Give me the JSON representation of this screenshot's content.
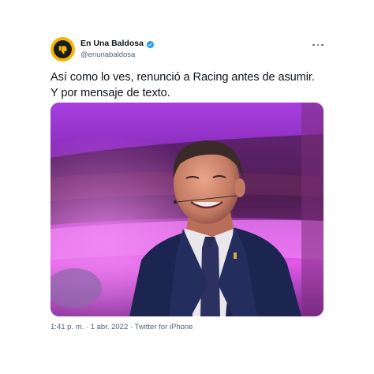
{
  "account": {
    "display_name": "En Una Baldosa",
    "handle": "@enunabaldosa",
    "verified": true,
    "avatar_icon": "thumbs-down-logo-icon",
    "avatar_color": "#f2b705"
  },
  "tweet": {
    "text": "Así como lo ves, renunció a Racing antes de asumir. Y por mensaje de texto.",
    "time": "1:41 p. m.",
    "date": "1 abr. 2022",
    "source": "Twitter for iPhone",
    "separator": "·"
  },
  "header": {
    "more_icon": "more-options-icon"
  },
  "colors": {
    "accent": "#1d9bf0",
    "text_primary": "#0f1419",
    "text_secondary": "#536471"
  }
}
